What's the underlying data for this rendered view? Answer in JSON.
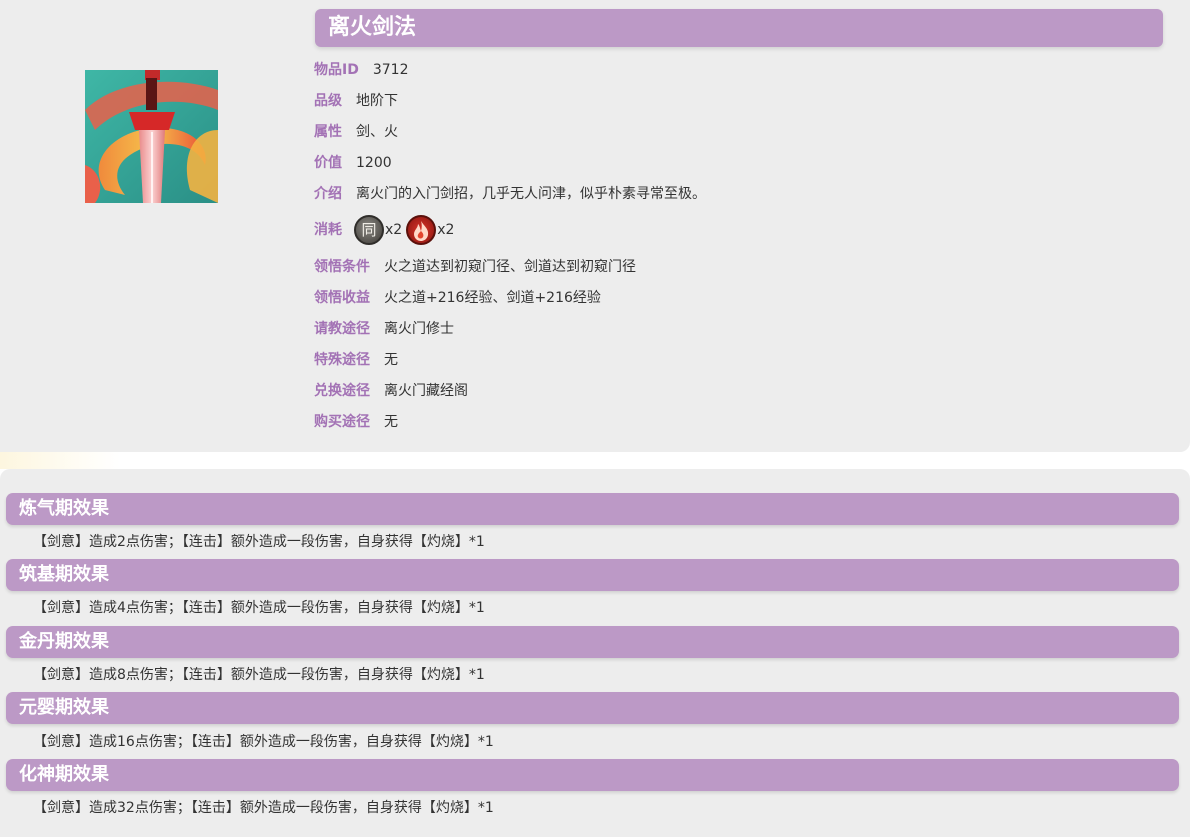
{
  "item": {
    "title": "离火剑法",
    "fields": [
      {
        "label": "物品ID",
        "value": "3712"
      },
      {
        "label": "品级",
        "value": "地阶下"
      },
      {
        "label": "属性",
        "value": "剑、火"
      },
      {
        "label": "价值",
        "value": "1200"
      },
      {
        "label": "介绍",
        "value": "离火门的入门剑招，几乎无人问津，似乎朴素寻常至极。"
      }
    ],
    "consume": {
      "label": "消耗",
      "items": [
        {
          "icon": "tong-coin-icon",
          "glyph": "同",
          "qty": "x2"
        },
        {
          "icon": "fire-orb-icon",
          "qty": "x2"
        }
      ]
    },
    "details": [
      {
        "label": "领悟条件",
        "value": "火之道达到初窥门径、剑道达到初窥门径"
      },
      {
        "label": "领悟收益",
        "value": "火之道+216经验、剑道+216经验"
      },
      {
        "label": "请教途径",
        "value": "离火门修士"
      },
      {
        "label": "特殊途径",
        "value": "无"
      },
      {
        "label": "兑换途径",
        "value": "离火门藏经阁"
      },
      {
        "label": "购买途径",
        "value": "无"
      }
    ]
  },
  "effects": [
    {
      "title": "炼气期效果",
      "desc": "【剑意】造成2点伤害；【连击】额外造成一段伤害，自身获得【灼烧】*1"
    },
    {
      "title": "筑基期效果",
      "desc": "【剑意】造成4点伤害；【连击】额外造成一段伤害，自身获得【灼烧】*1"
    },
    {
      "title": "金丹期效果",
      "desc": "【剑意】造成8点伤害；【连击】额外造成一段伤害，自身获得【灼烧】*1"
    },
    {
      "title": "元婴期效果",
      "desc": "【剑意】造成16点伤害；【连击】额外造成一段伤害，自身获得【灼烧】*1"
    },
    {
      "title": "化神期效果",
      "desc": "【剑意】造成32点伤害；【连击】额外造成一段伤害，自身获得【灼烧】*1"
    }
  ],
  "colors": {
    "accent": "#bc99c6",
    "label": "#a372b5",
    "panel": "#ededed"
  }
}
